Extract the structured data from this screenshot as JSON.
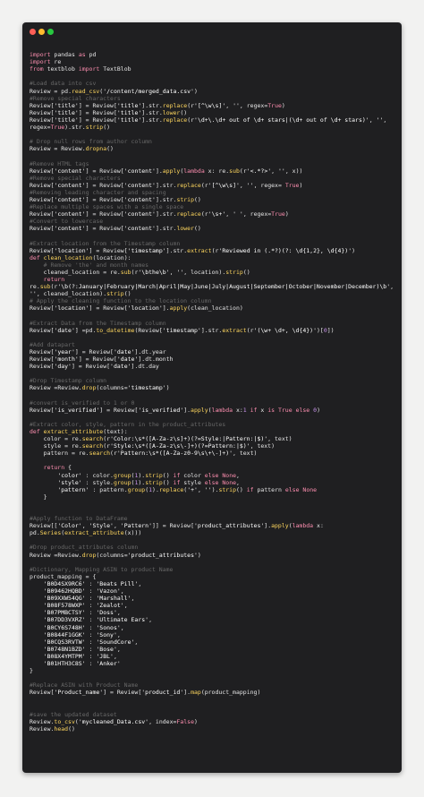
{
  "window": {
    "controls": {
      "close_color": "#ff5f57",
      "minimize_color": "#febc2e",
      "maximize_color": "#28c840"
    }
  },
  "code_lines": [
    "",
    "import pandas as pd",
    "import re",
    "from textblob import TextBlob",
    "",
    "#Load data into csv",
    "Review = pd.read_csv('/content/merged_data.csv')",
    "#Remove special characters",
    "Review['title'] = Review['title'].str.replace(r'[^\\w\\s]', '', regex=True)",
    "Review['title'] = Review['title'].str.lower()",
    "Review['title'] = Review['title'].str.replace(r'\\d+\\.\\d+ out of \\d+ stars|(\\d+ out of \\d+ stars)', '',",
    "regex=True).str.strip()",
    "",
    "# Drop null rows from author column",
    "Review = Review.dropna()",
    "",
    "#Remove HTML tags",
    "Review['content'] = Review['content'].apply(lambda x: re.sub(r'<.*?>', '', x))",
    "#Remove special characters",
    "Review['content'] = Review['content'].str.replace(r'[^\\w\\s]', '', regex= True)",
    "#Removing leading character and spacing",
    "Review['content'] = Review['content'].str.strip()",
    "#Replace multiple spaces with a single space",
    "Review['content'] = Review['content'].str.replace(r'\\s+', ' ', regex=True)",
    "#Convert to lowercase",
    "Review['content'] = Review['content'].str.lower()",
    "",
    "#Extract location from the Timestamp column",
    "Review['location'] = Review['timestamp'].str.extract(r'Reviewed in (.*?)(?: \\d{1,2}, \\d{4})')",
    "def clean_location(location):",
    "    # Remove 'the' and month names",
    "    cleaned_location = re.sub(r'\\bthe\\b', '', location).strip()",
    "    return",
    "re.sub(r'\\b(?:January|February|March|April|May|June|July|August|September|October|November|December)\\b',",
    "'', cleaned_location).strip()",
    "# Apply the cleaning function to the location column",
    "Review['location'] = Review['location'].apply(clean_location)",
    "",
    "#Extract Data from the Timestamp column",
    "Review['date'] =pd.to_datetime(Review['timestamp'].str.extract(r'(\\w+ \\d+, \\d{4})')[0])",
    "",
    "#Add datapart",
    "Review['year'] = Review['date'].dt.year",
    "Review['month'] = Review['date'].dt.month",
    "Review['day'] = Review['date'].dt.day",
    "",
    "#Drop Timestamp column",
    "Review =Review.drop(columns='timestamp')",
    "",
    "#convert is_verified to 1 or 0",
    "Review['is_verified'] = Review['is_verified'].apply(lambda x:1 if x is True else 0)",
    "",
    "#Extract color, style, pattern in the product_attributes",
    "def extract_attribute(text):",
    "    color = re.search(r'Color:\\s*([A-Za-z\\s]+)(?=Style:|Pattern:|$)', text)",
    "    style = re.search(r'Style:\\s*([A-Za-z\\s\\-]+)(?=Pattern:|$)', text)",
    "    pattern = re.search(r'Pattern:\\s*([A-Za-z0-9\\s\\+\\-]+)', text)",
    "",
    "    return {",
    "        'color' : color.group(1).strip() if color else None,",
    "        'style' : style.group(1).strip() if style else None,",
    "        'pattern' : pattern.group(1).replace('+', '').strip() if pattern else None",
    "    }",
    "",
    "",
    "#Apply function to DataFrame",
    "Review[['Color', 'Style', 'Pattern']] = Review['product_attributes'].apply(lambda x:",
    "pd.Series(extract_attribute(x)))",
    "",
    "#Drop product_attributes column",
    "Review =Review.drop(columns='product_attributes')",
    "",
    "#Dictionary, Mapping ASIN to product Name",
    "product_mapping = {",
    "    'B0D4SX9RC6' : 'Beats Pill',",
    "    'B09462HQBD' : 'Vazon',",
    "    'B09XXW54QG' : 'Marshall',",
    "    'B08F578WXP' : 'Zealot',",
    "    'B07PMBCTSY' : 'Doss',",
    "    'B07DD3VXRZ' : 'Ultimate Ears',",
    "    'B0CY6S748H' : 'Sonos',",
    "    'B0844F1GGK' : 'Sony',",
    "    'B0CQS3RVTW' : 'SoundCore',",
    "    'B0748N1BZD' : 'Bose',",
    "    'B08X4YMTPM' : 'JBL',",
    "    'B01HTH3C8S' : 'Anker'",
    "}",
    "",
    "#Replace ASIN with Product Name",
    "Review['Product_name'] = Review['product_id'].map(product_mapping)",
    "",
    "",
    "#save the updated dataset",
    "Review.to_csv('mycleaned_Data.csv', index=False)",
    "Review.head()"
  ]
}
